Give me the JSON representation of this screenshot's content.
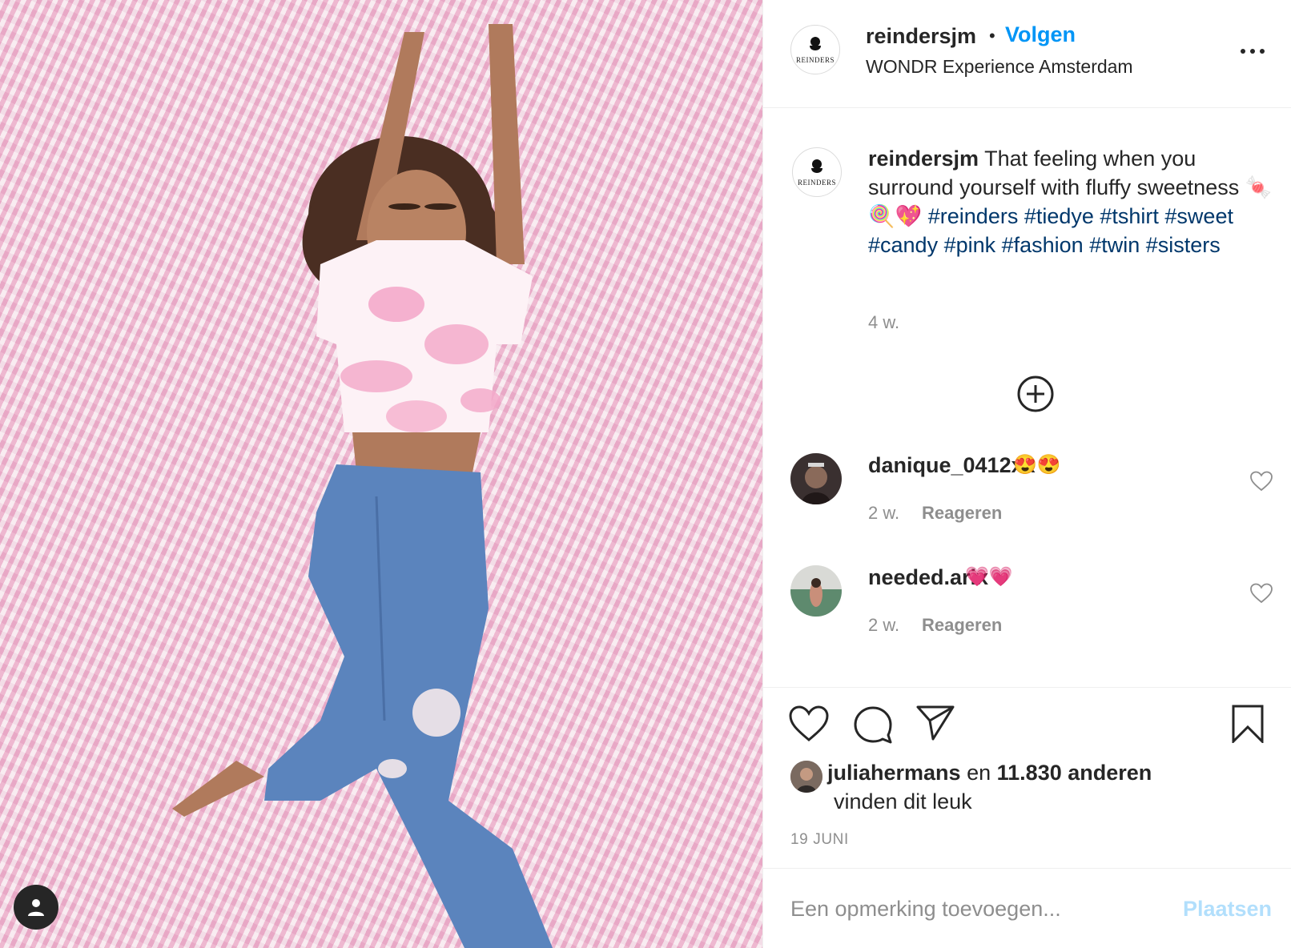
{
  "post": {
    "author": "reindersjm",
    "follow_label": "Volgen",
    "location": "WONDR Experience Amsterdam",
    "avatar_brand": "REINDERS"
  },
  "caption": {
    "author": "reindersjm",
    "text": "That feeling when you surround yourself with fluffy sweetness",
    "emojis": "🍬🍭💖",
    "hashtags": "#reinders #tiedye #tshirt #sweet #candy #pink #fashion #twin #sisters",
    "age": "4 w."
  },
  "comments": [
    {
      "user": "danique_0412xx",
      "emoji": "😍😍",
      "age": "2 w.",
      "reply_label": "Reageren"
    },
    {
      "user": "needed.arix",
      "emoji": "💗💗",
      "age": "2 w.",
      "reply_label": "Reageren"
    }
  ],
  "likes": {
    "first_user": "juliahermans",
    "connector": "en",
    "others": "11.830 anderen",
    "suffix": "vinden dit leuk"
  },
  "date": "19 JUNI",
  "comment_box": {
    "placeholder": "Een opmerking toevoegen...",
    "post_label": "Plaatsen"
  },
  "icons": {
    "more": "more-options-icon",
    "load_more": "plus-circle-icon",
    "like": "heart-icon",
    "comment": "comment-bubble-icon",
    "share": "paper-plane-icon",
    "save": "bookmark-icon",
    "user_tags": "user-icon"
  },
  "colors": {
    "link": "#0095f6",
    "hashtag": "#00376b",
    "muted": "#8e8e8e",
    "post_disabled": "#b2dffc",
    "photo_bg": "#e9c3d3"
  }
}
